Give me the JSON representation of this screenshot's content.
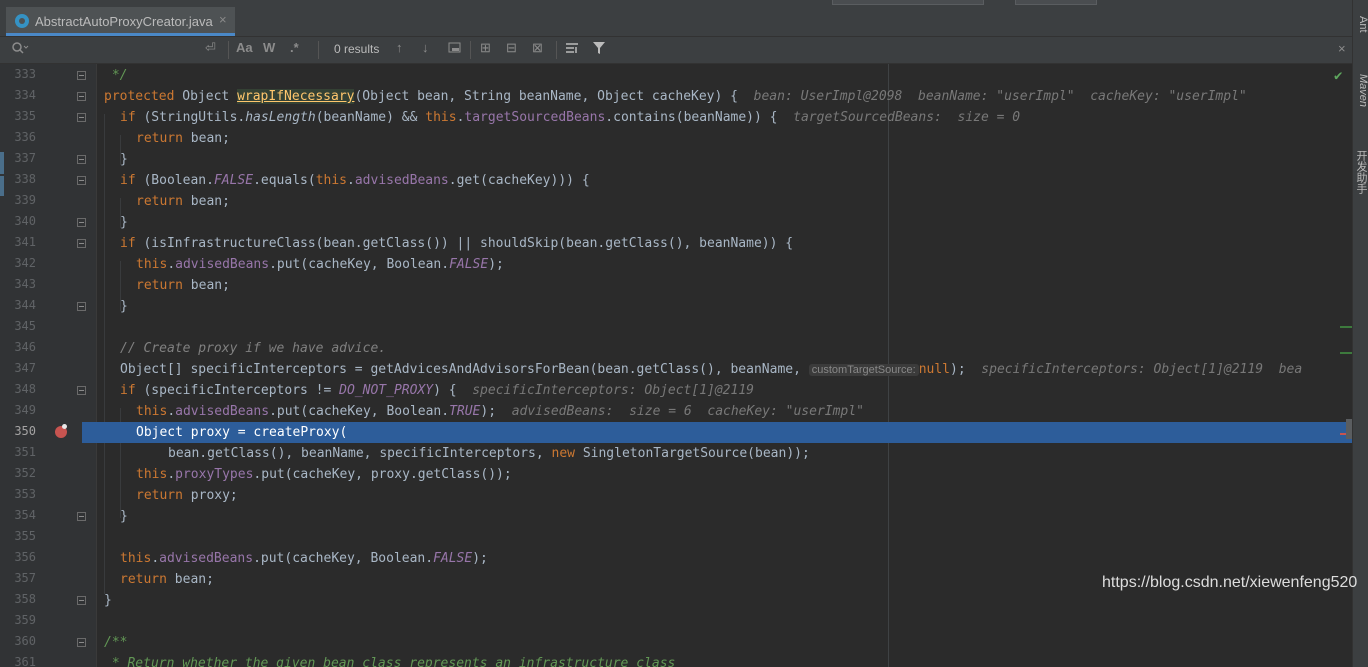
{
  "tab": {
    "title": "AbstractAutoProxyCreator.java",
    "close": "×"
  },
  "find": {
    "placeholder": "",
    "results": "0 results",
    "icons": [
      "search-icon",
      "regex-enter-icon",
      "match-case-icon",
      "words-icon",
      "regex-icon",
      "prev-icon",
      "next-icon",
      "select-all-icon",
      "add-cursor-icon",
      "remove-cursor-icon",
      "select-occurrences-icon",
      "in-selection-icon",
      "filter-icon",
      "close-icon"
    ],
    "case_label": "Aa",
    "words_label": "W",
    "regex_label": ".*",
    "close": "×"
  },
  "right_tools": {
    "ant": "Ant",
    "maven": "Maven",
    "assist": "开发助手"
  },
  "watermark": "https://blog.csdn.net/xiewenfeng520",
  "colors": {
    "keyword": "#cc7832",
    "field": "#9876aa",
    "comment": "#808080",
    "doc": "#629755",
    "method_decl": "#ffc66d",
    "current_line": "#2d5d9a",
    "breakpoint": "#c75450"
  },
  "code": {
    "l333": {
      "num": "333",
      "t": " */"
    },
    "l334": {
      "num": "334",
      "kw": "protected",
      "t1": " Object ",
      "fn": "wrapIfNecessary",
      "t2": "(Object bean, String beanName, Object cacheKey) {",
      "dbg": "  bean: UserImpl@2098  beanName: \"userImpl\"  cacheKey: \"userImpl\""
    },
    "l335": {
      "num": "335",
      "kw1": "if",
      "t1": " (StringUtils.",
      "sm": "hasLength",
      "t2": "(beanName) && ",
      "kw2": "this",
      "t3": ".",
      "fld": "targetSourcedBeans",
      "t4": ".contains(beanName)) {",
      "dbg": "  targetSourcedBeans:  size = 0"
    },
    "l336": {
      "num": "336",
      "kw": "return",
      "t": " bean;"
    },
    "l337": {
      "num": "337",
      "t": "}"
    },
    "l338": {
      "num": "338",
      "kw1": "if",
      "t1": " (Boolean.",
      "sf": "FALSE",
      "t2": ".equals(",
      "kw2": "this",
      "t3": ".",
      "fld": "advisedBeans",
      "t4": ".get(cacheKey))) {"
    },
    "l339": {
      "num": "339",
      "kw": "return",
      "t": " bean;"
    },
    "l340": {
      "num": "340",
      "t": "}"
    },
    "l341": {
      "num": "341",
      "kw": "if",
      "t": " (isInfrastructureClass(bean.getClass()) || shouldSkip(bean.getClass(), beanName)) {"
    },
    "l342": {
      "num": "342",
      "kw": "this",
      "t1": ".",
      "fld": "advisedBeans",
      "t2": ".put(cacheKey, Boolean.",
      "sf": "FALSE",
      "t3": ");"
    },
    "l343": {
      "num": "343",
      "kw": "return",
      "t": " bean;"
    },
    "l344": {
      "num": "344",
      "t": "}"
    },
    "l345": {
      "num": "345"
    },
    "l346": {
      "num": "346",
      "cm": "// Create proxy if we have advice."
    },
    "l347": {
      "num": "347",
      "t1": "Object[] specificInterceptors = getAdvicesAndAdvisorsForBean(bean.getClass(), beanName, ",
      "hint": "customTargetSource:",
      "kw": "null",
      "t2": ");",
      "dbg": "  specificInterceptors: Object[1]@2119  bea"
    },
    "l348": {
      "num": "348",
      "kw": "if",
      "t1": " (specificInterceptors != ",
      "sf": "DO_NOT_PROXY",
      "t2": ") {",
      "dbg": "  specificInterceptors: Object[1]@2119"
    },
    "l349": {
      "num": "349",
      "kw1": "this",
      "t1": ".",
      "fld": "advisedBeans",
      "t2": ".put(cacheKey, Boolean.",
      "sf": "TRUE",
      "t3": ");",
      "dbg": "  advisedBeans:  size = 6  cacheKey: \"userImpl\""
    },
    "l350": {
      "num": "350",
      "t": "Object proxy = createProxy("
    },
    "l351": {
      "num": "351",
      "t1": "bean.getClass(), beanName, specificInterceptors, ",
      "kw": "new",
      "t2": " SingletonTargetSource(bean));"
    },
    "l352": {
      "num": "352",
      "kw": "this",
      "t1": ".",
      "fld": "proxyTypes",
      "t2": ".put(cacheKey, proxy.getClass());"
    },
    "l353": {
      "num": "353",
      "kw": "return",
      "t": " proxy;"
    },
    "l354": {
      "num": "354",
      "t": "}"
    },
    "l355": {
      "num": "355"
    },
    "l356": {
      "num": "356",
      "kw": "this",
      "t1": ".",
      "fld": "advisedBeans",
      "t2": ".put(cacheKey, Boolean.",
      "sf": "FALSE",
      "t3": ");"
    },
    "l357": {
      "num": "357",
      "kw": "return",
      "t": " bean;"
    },
    "l358": {
      "num": "358",
      "t": "}"
    },
    "l359": {
      "num": "359"
    },
    "l360": {
      "num": "360",
      "doc": "/**"
    },
    "l361": {
      "num": "361",
      "doc": " * Return whether the given bean class represents an infrastructure class"
    }
  }
}
